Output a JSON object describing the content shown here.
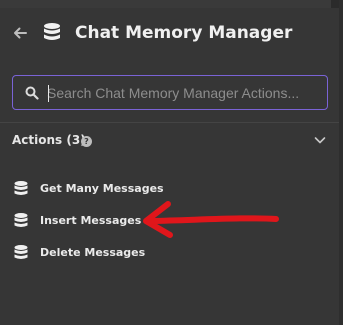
{
  "header": {
    "title": "Chat Memory Manager",
    "back_icon": "arrow-left-icon",
    "app_icon": "database-icon"
  },
  "search": {
    "placeholder": "Search Chat Memory Manager Actions...",
    "value": "",
    "icon": "search-icon",
    "focus_color": "#7a63d6"
  },
  "actions_section": {
    "title": "Actions (3)",
    "help_icon": "help-circle-icon",
    "expand_icon": "chevron-down-icon"
  },
  "actions": [
    {
      "label": "Get Many Messages",
      "icon": "database-icon"
    },
    {
      "label": "Insert Messages",
      "icon": "database-icon"
    },
    {
      "label": "Delete Messages",
      "icon": "database-icon"
    }
  ],
  "annotation": {
    "shape": "red-arrow",
    "color": "#e0161b",
    "points_to": "Insert Messages"
  }
}
